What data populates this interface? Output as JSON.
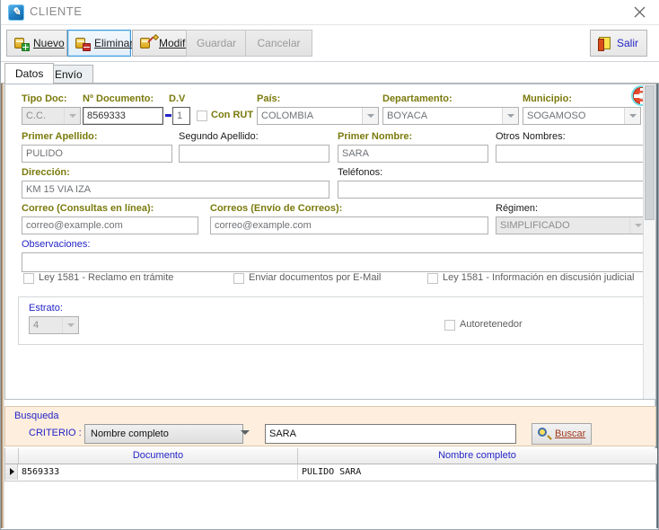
{
  "window": {
    "title": "CLIENTE",
    "app_icon": "app-logo-icon",
    "close_icon": "close-icon"
  },
  "toolbar": {
    "buttons": [
      {
        "label": "Nuevo",
        "icon": "new-record-icon",
        "state": "enabled"
      },
      {
        "label": "Eliminar",
        "icon": "delete-record-icon",
        "state": "selected"
      },
      {
        "label": "Modificar",
        "icon": "edit-record-icon",
        "state": "enabled"
      },
      {
        "label": "Guardar",
        "icon": "save-icon",
        "state": "disabled"
      },
      {
        "label": "Cancelar",
        "icon": "cancel-icon",
        "state": "disabled"
      }
    ],
    "exit": {
      "label": "Salir",
      "icon": "exit-door-icon"
    }
  },
  "tabs": [
    {
      "label": "Datos",
      "active": true
    },
    {
      "label": "Envío",
      "active": false
    }
  ],
  "help_icon": "lifesaver-help-icon",
  "form": {
    "tipo_doc": {
      "label": "Tipo Doc:",
      "value": "C.C.",
      "disabled": true
    },
    "num_doc": {
      "label": "Nº Documento:",
      "value": "8569333"
    },
    "dv": {
      "label": "D.V",
      "value": "1"
    },
    "con_rut": {
      "label": "Con RUT",
      "checked": false
    },
    "pais": {
      "label": "País:",
      "value": "COLOMBIA"
    },
    "departamento": {
      "label": "Departamento:",
      "value": "BOYACA"
    },
    "municipio": {
      "label": "Municipio:",
      "value": "SOGAMOSO"
    },
    "primer_apellido": {
      "label": "Primer Apellido:",
      "value": "PULIDO"
    },
    "segundo_apellido": {
      "label": "Segundo Apellido:",
      "value": ""
    },
    "primer_nombre": {
      "label": "Primer Nombre:",
      "value": "SARA"
    },
    "otros_nombres": {
      "label": "Otros Nombres:",
      "value": ""
    },
    "direccion": {
      "label": "Dirección:",
      "value": "KM 15 VIA IZA"
    },
    "telefonos": {
      "label": "Teléfonos:",
      "value": ""
    },
    "correo_consultas": {
      "label": "Correo (Consultas en línea):",
      "value": "correo@example.com"
    },
    "correos_envio": {
      "label": "Correos (Envío de Correos):",
      "value": "correo@example.com"
    },
    "regimen": {
      "label": "Régimen:",
      "value": "SIMPLIFICADO",
      "disabled": true
    },
    "observaciones": {
      "label": "Observaciones:",
      "value": ""
    },
    "checks": [
      {
        "label": "Ley 1581 - Reclamo en trámite",
        "checked": false
      },
      {
        "label": "Enviar documentos por E-Mail",
        "checked": false
      },
      {
        "label": "Ley 1581 - Información en discusión judicial",
        "checked": false
      }
    ],
    "estrato": {
      "label": "Estrato:",
      "value": "4",
      "disabled": true
    },
    "autoretenedor": {
      "label": "Autoretenedor",
      "checked": false
    }
  },
  "search": {
    "title": "Busqueda",
    "criterio_label": "CRITERIO :",
    "criterio_value": "Nombre completo",
    "query": "SARA",
    "button_label": "Buscar",
    "button_icon": "magnifier-icon"
  },
  "results": {
    "columns": [
      "Documento",
      "Nombre completo"
    ],
    "rows": [
      {
        "documento": "8569333",
        "nombre": "PULIDO  SARA",
        "selected": true
      }
    ]
  },
  "colors": {
    "required_label": "#7a7a0d",
    "blue_label": "#2424c8",
    "search_panel_bg": "#fdeedd",
    "accent_selected": "#3c99dc"
  }
}
